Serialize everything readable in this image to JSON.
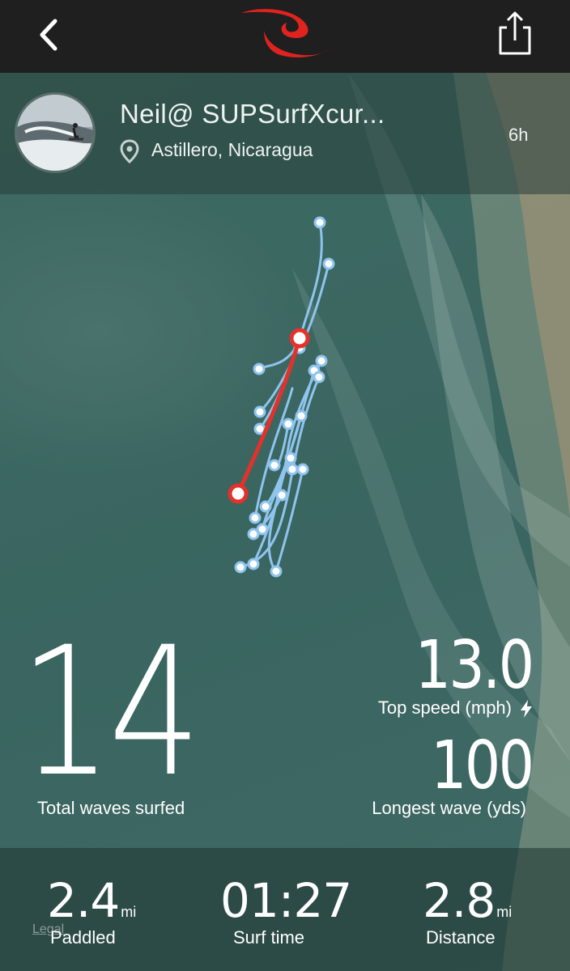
{
  "header": {
    "back_icon": "chevron-left-icon",
    "logo": "rip-curl-logo",
    "share_icon": "share-icon"
  },
  "profile": {
    "username": "Neil@ SUPSurfXcur...",
    "location": "Astillero, Nicaragua",
    "time_ago": "6h",
    "pin_icon": "location-pin-icon"
  },
  "stats": {
    "total_waves": "14",
    "total_waves_label": "Total waves surfed",
    "top_speed": "13.0",
    "top_speed_label": "Top speed (mph)",
    "longest_wave": "100",
    "longest_wave_label": "Longest wave (yds)"
  },
  "summary": {
    "paddled": "2.4",
    "paddled_unit": "mi",
    "paddled_label": "Paddled",
    "surf_time": "01:27",
    "surf_time_label": "Surf time",
    "distance": "2.8",
    "distance_unit": "mi",
    "distance_label": "Distance",
    "legal": "Legal"
  },
  "colors": {
    "track_wave": "#8ec4ee",
    "highlight_wave": "#e4312b",
    "header_bg": "#1f1f1f",
    "logo_red": "#e0231f"
  }
}
